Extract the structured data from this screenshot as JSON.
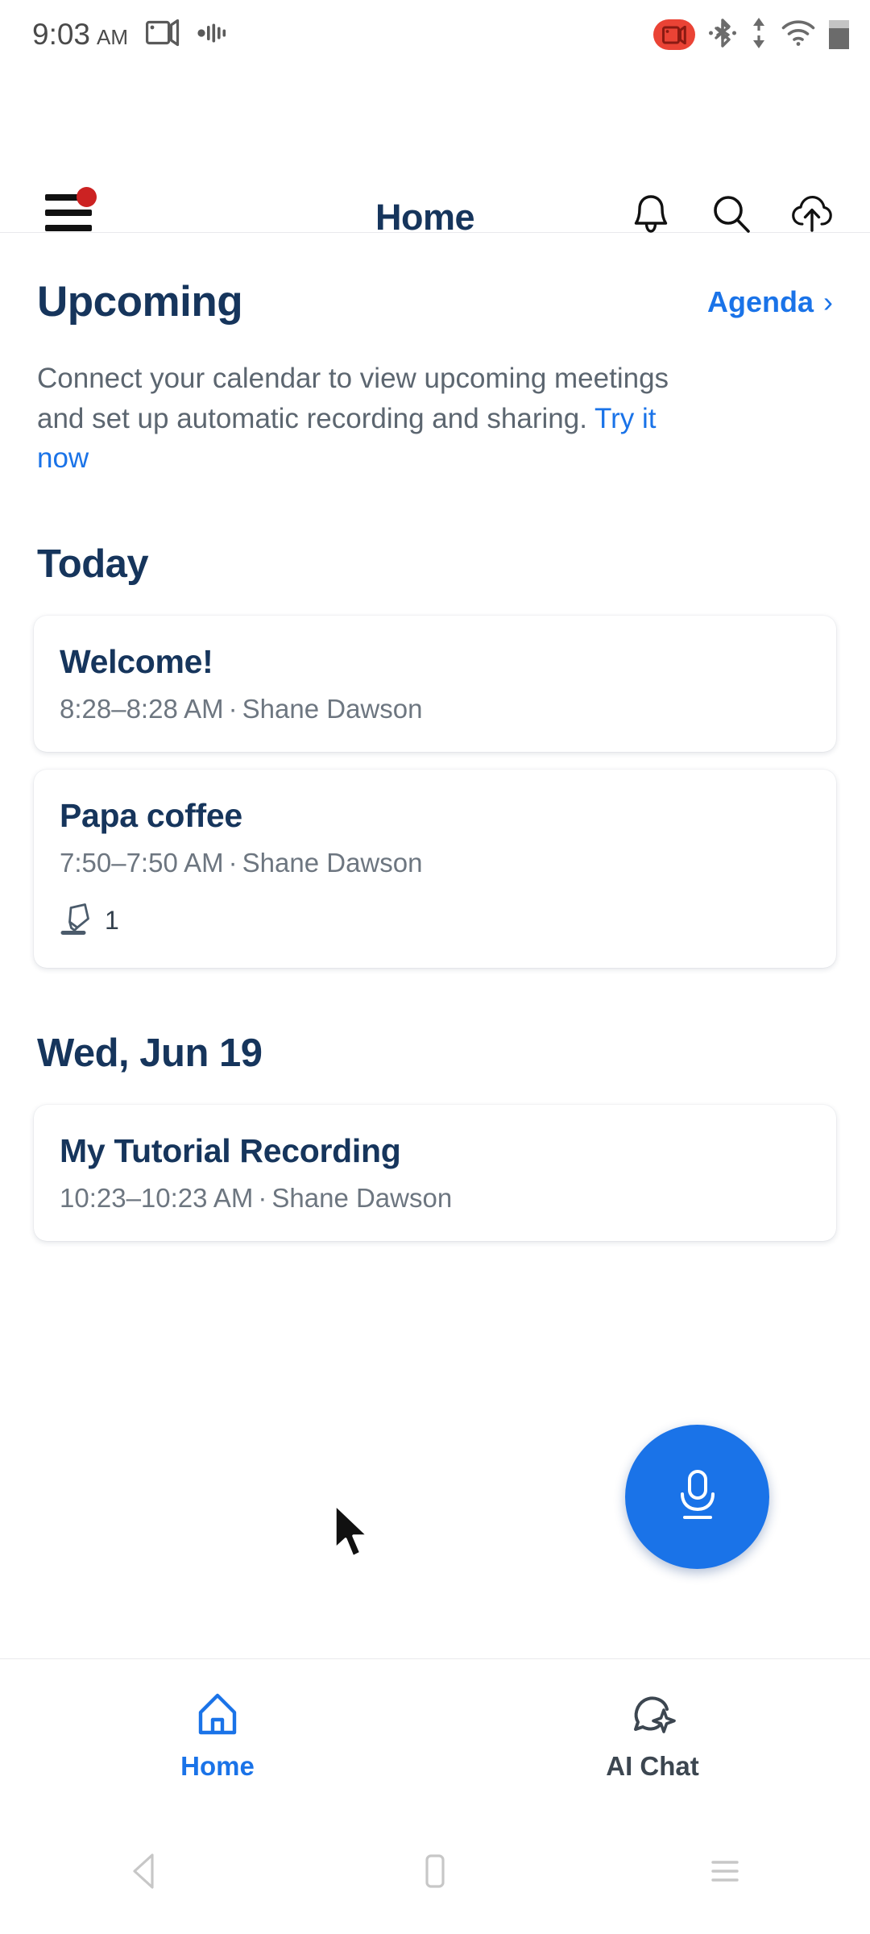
{
  "status_bar": {
    "time": "9:03",
    "ampm": "AM",
    "left_icons": [
      "screen-cast-icon",
      "audio-waveform-icon"
    ],
    "right_icons": [
      "screen-recording-badge-icon",
      "bluetooth-icon",
      "data-transfer-icon",
      "wifi-icon",
      "battery-icon"
    ]
  },
  "header": {
    "menu_icon": "hamburger-menu-icon",
    "badge": "notification-dot",
    "title": "Home",
    "actions": [
      {
        "name": "notifications-bell-icon"
      },
      {
        "name": "search-icon"
      },
      {
        "name": "cloud-upload-icon"
      }
    ]
  },
  "upcoming": {
    "title": "Upcoming",
    "agenda_label": "Agenda",
    "chevron": "›",
    "blurb_text": "Connect your calendar to view upcoming meetings and set up automatic recording and sharing. ",
    "blurb_link": "Try it now"
  },
  "sections": [
    {
      "day_label": "Today",
      "items": [
        {
          "title": "Welcome!",
          "time": "8:28–8:28 AM",
          "separator": "·",
          "owner": "Shane Dawson",
          "has_footer": false,
          "footer_icon": "",
          "footer_count": ""
        },
        {
          "title": "Papa coffee",
          "time": "7:50–7:50 AM",
          "separator": "·",
          "owner": "Shane Dawson",
          "has_footer": true,
          "footer_icon": "highlighter-icon",
          "footer_count": "1"
        }
      ]
    },
    {
      "day_label": "Wed, Jun 19",
      "items": [
        {
          "title": "My Tutorial Recording",
          "time": "10:23–10:23 AM",
          "separator": "·",
          "owner": "Shane Dawson",
          "has_footer": false,
          "footer_icon": "",
          "footer_count": ""
        }
      ]
    }
  ],
  "fab": {
    "icon": "microphone-icon",
    "color": "#1a73e8"
  },
  "bottom_nav": {
    "items": [
      {
        "label": "Home",
        "icon": "home-icon",
        "active": true
      },
      {
        "label": "AI Chat",
        "icon": "ai-chat-sparkle-icon",
        "active": false
      }
    ]
  },
  "system_nav": {
    "back": "back-triangle-icon",
    "home": "home-square-icon",
    "recents": "recents-lines-icon"
  },
  "cursor": {
    "icon": "mouse-pointer-icon"
  },
  "colors": {
    "accent_blue": "#1a73e8",
    "heading_navy": "#16355c",
    "muted_gray": "#6d7680",
    "badge_red": "#cc2222",
    "rec_red": "#ea4335"
  }
}
